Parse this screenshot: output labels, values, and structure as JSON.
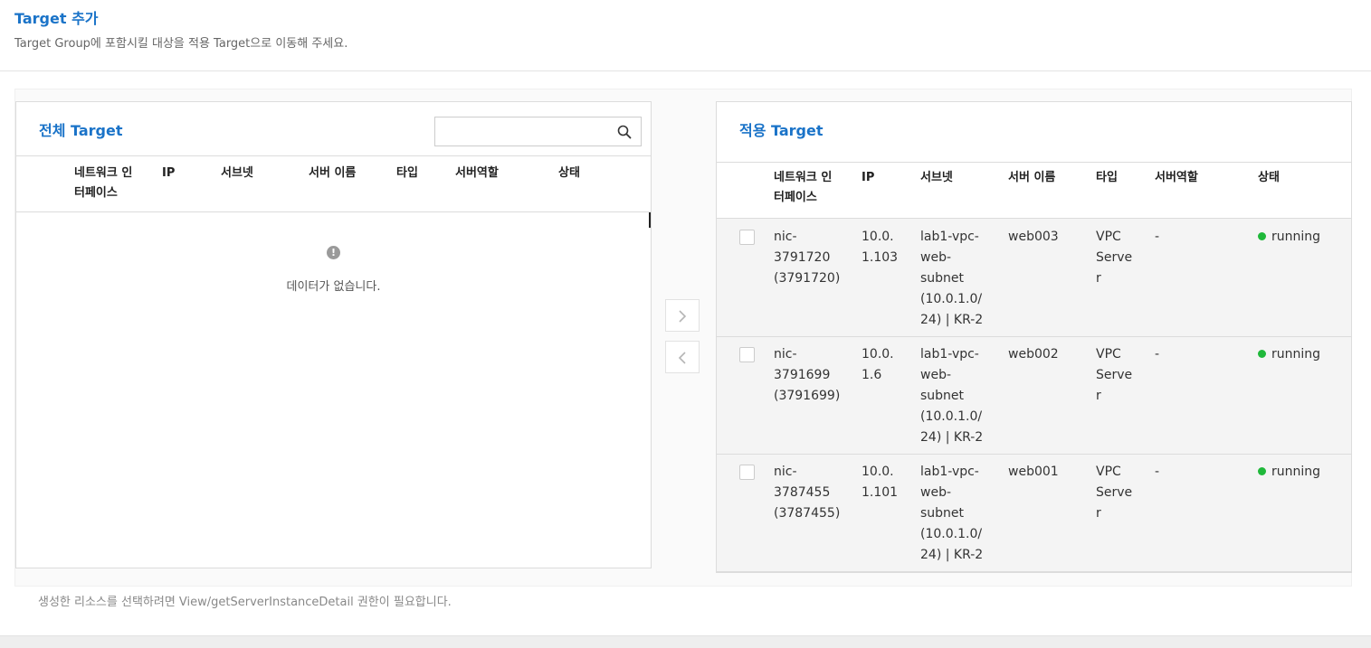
{
  "header": {
    "title": "Target 추가",
    "description": "Target Group에 포함시킬 대상을 적용 Target으로 이동해 주세요."
  },
  "all_panel": {
    "title": "전체 Target",
    "search_placeholder": "",
    "empty_message": "데이터가 없습니다.",
    "columns": [
      "네트워크 인\n터페이스",
      "IP",
      "서브넷",
      "서버 이름",
      "타입",
      "서버역할",
      "상태"
    ]
  },
  "applied_panel": {
    "title": "적용 Target",
    "columns": [
      "네트워크 인\n터페이스",
      "IP",
      "서브넷",
      "서버 이름",
      "타입",
      "서버역할",
      "상태"
    ],
    "rows": [
      {
        "nic": "nic-\n3791720\n(3791720)",
        "ip": "10.0.\n1.103",
        "subnet": "lab1-vpc-\nweb-\nsubnet\n(10.0.1.0/\n24) | KR-2",
        "server": "web003",
        "type": "VPC\nServe\nr",
        "role": "-",
        "status": "running"
      },
      {
        "nic": "nic-\n3791699\n(3791699)",
        "ip": "10.0.\n1.6",
        "subnet": "lab1-vpc-\nweb-\nsubnet\n(10.0.1.0/\n24) | KR-2",
        "server": "web002",
        "type": "VPC\nServe\nr",
        "role": "-",
        "status": "running"
      },
      {
        "nic": "nic-\n3787455\n(3787455)",
        "ip": "10.0.\n1.101",
        "subnet": "lab1-vpc-\nweb-\nsubnet\n(10.0.1.0/\n24) | KR-2",
        "server": "web001",
        "type": "VPC\nServe\nr",
        "role": "-",
        "status": "running"
      }
    ]
  },
  "move_buttons": {
    "add_icon": "chevron-right-icon",
    "remove_icon": "chevron-left-icon"
  },
  "footnote": "생성한 리소스를 선택하려면 View/getServerInstanceDetail 권한이 필요합니다.",
  "colors": {
    "accent": "#1a73c8",
    "status_running": "#1fb83a"
  }
}
